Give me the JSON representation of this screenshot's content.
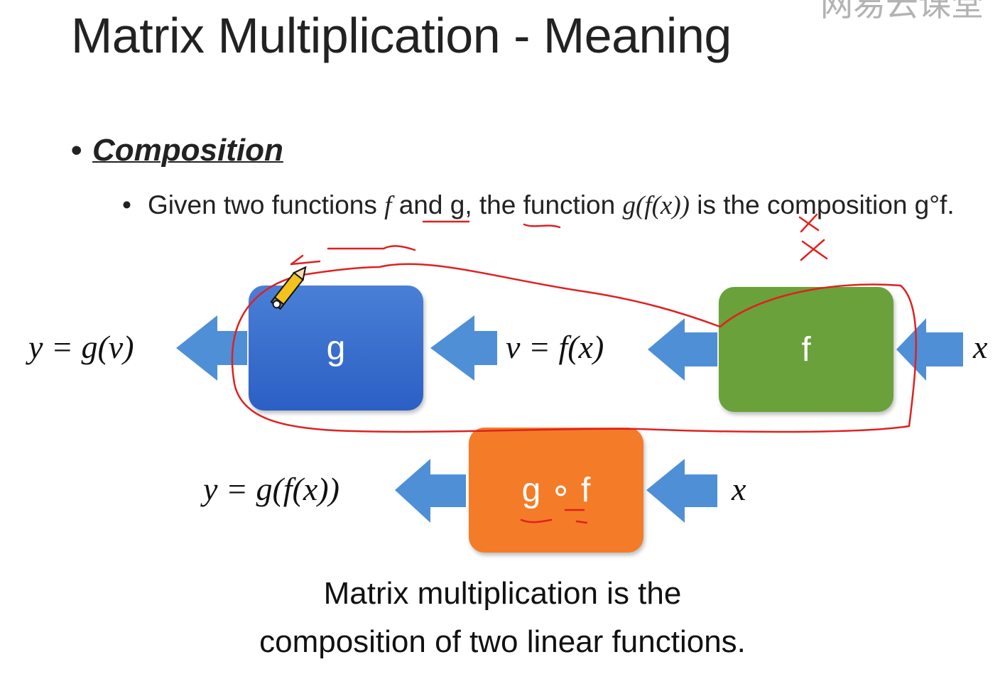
{
  "title": "Matrix Multiplication - Meaning",
  "watermark": "网易云课堂",
  "bullet_main": "Composition",
  "bullet_sub": {
    "part1": "Given two functions ",
    "f": "f",
    "part2": " and g, the function ",
    "gf_expr": "g(f(x))",
    "part3": " is the composition g°f."
  },
  "boxes": {
    "g": "g",
    "f": "f",
    "gf": "g ∘ f"
  },
  "labels": {
    "y_gv": "y = g(v)",
    "v_fx": "v = f(x)",
    "x_right": "x",
    "y_gfx": "y = g(f(x))",
    "x_bottom": "x"
  },
  "caption_line1": "Matrix multiplication is the",
  "caption_line2": "composition of two linear functions.",
  "colors": {
    "g": "#3a6fd0",
    "f": "#6aa13a",
    "gf": "#f47c28",
    "arrow": "#4f8fd6",
    "annotation": "#e02020"
  }
}
